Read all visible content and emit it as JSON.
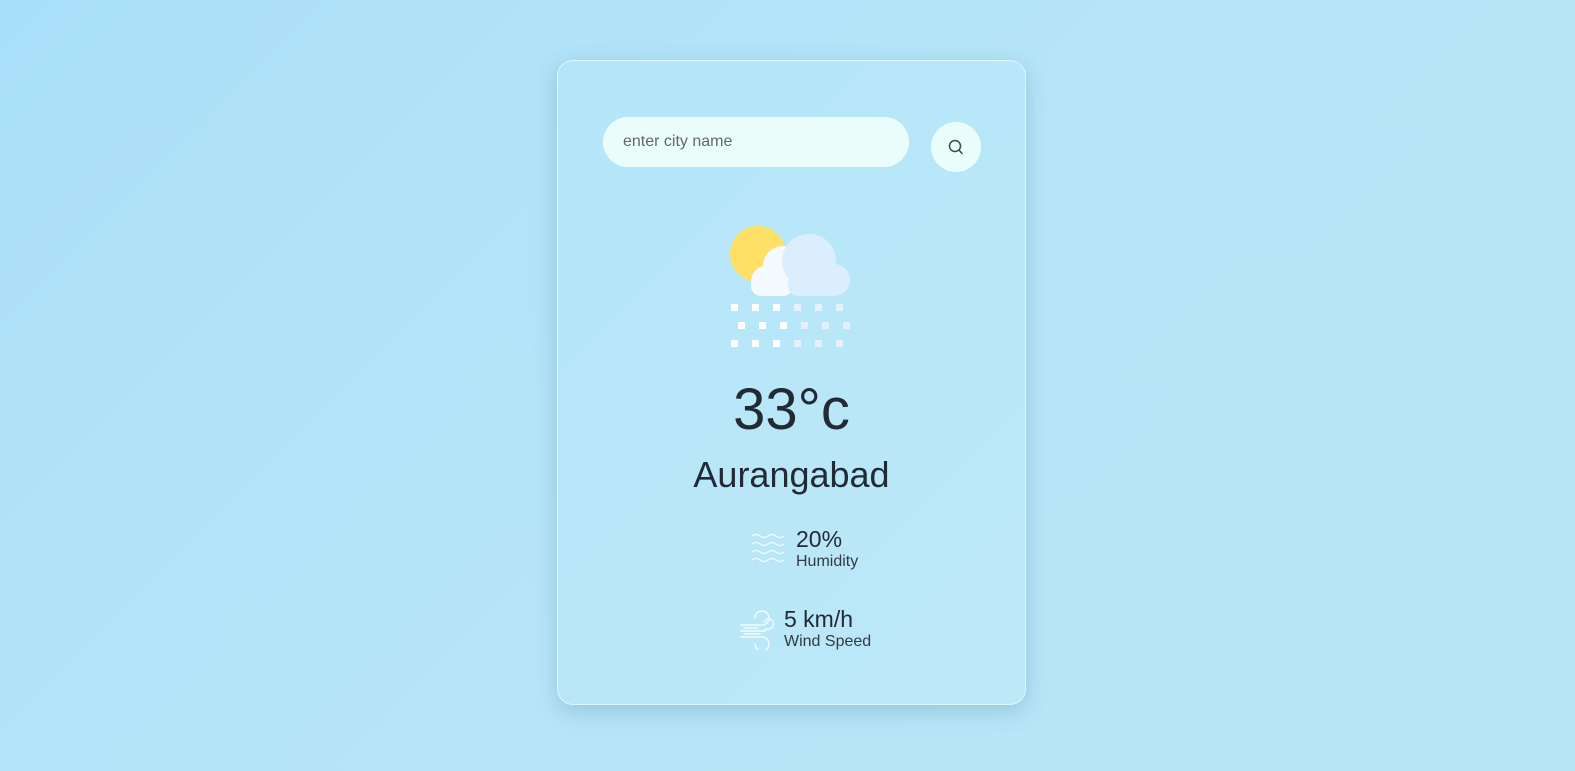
{
  "search": {
    "placeholder": "enter city name",
    "value": ""
  },
  "weather": {
    "icon": "sun-cloud-snow-icon",
    "temperature": "33°c",
    "city": "Aurangabad"
  },
  "details": {
    "humidity": {
      "icon": "humidity-waves-icon",
      "value": "20%",
      "label": "Humidity"
    },
    "wind": {
      "icon": "wind-icon",
      "value": "5 km/h",
      "label": "Wind Speed"
    }
  },
  "colors": {
    "background": "#b2e3f8",
    "card": "#b8e7f8",
    "input": "#ebfdfb",
    "text": "#222a35",
    "sun": "#ffe066"
  }
}
